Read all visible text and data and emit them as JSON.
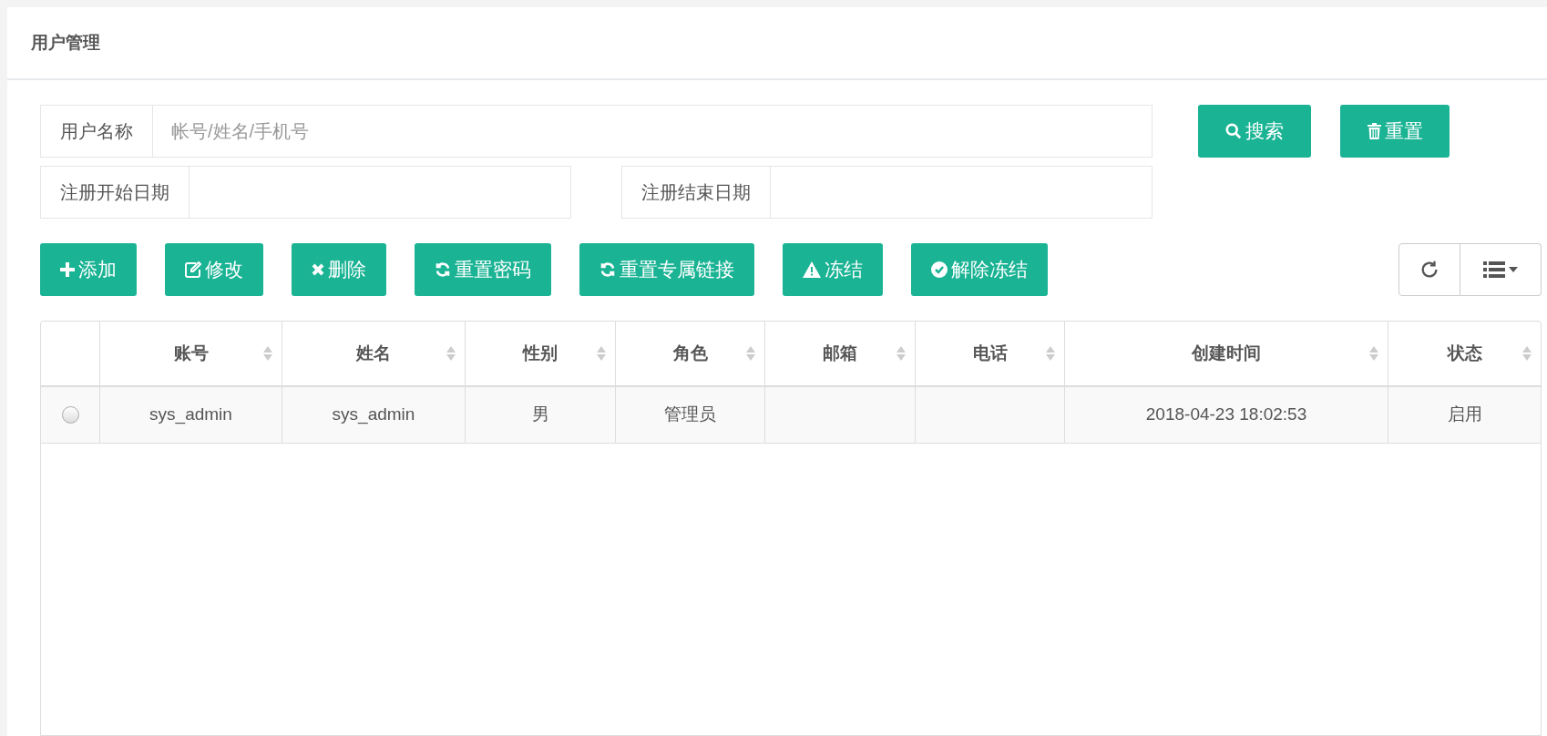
{
  "page_title": "用户管理",
  "filters": [
    {
      "label": "用户名称",
      "placeholder": "帐号/姓名/手机号",
      "kind": "wide"
    },
    {
      "label": "注册开始日期",
      "kind": "half"
    },
    {
      "label": "注册结束日期",
      "kind": "half"
    }
  ],
  "search_buttons": [
    {
      "label": "搜索"
    },
    {
      "label": "重置"
    }
  ],
  "toolbar": [
    {
      "label": "添加"
    },
    {
      "label": "修改"
    },
    {
      "label": "删除"
    },
    {
      "label": "重置密码"
    },
    {
      "label": "重置专属链接"
    },
    {
      "label": "冻结"
    },
    {
      "label": "解除冻结"
    }
  ],
  "table": {
    "columns": [
      "账号",
      "姓名",
      "性别",
      "角色",
      "邮箱",
      "电话",
      "创建时间",
      "状态"
    ],
    "rows": [
      {
        "selected": false,
        "cells": [
          "sys_admin",
          "sys_admin",
          "男",
          "管理员",
          "",
          "",
          "2018-04-23 18:02:53",
          "启用"
        ]
      }
    ]
  }
}
